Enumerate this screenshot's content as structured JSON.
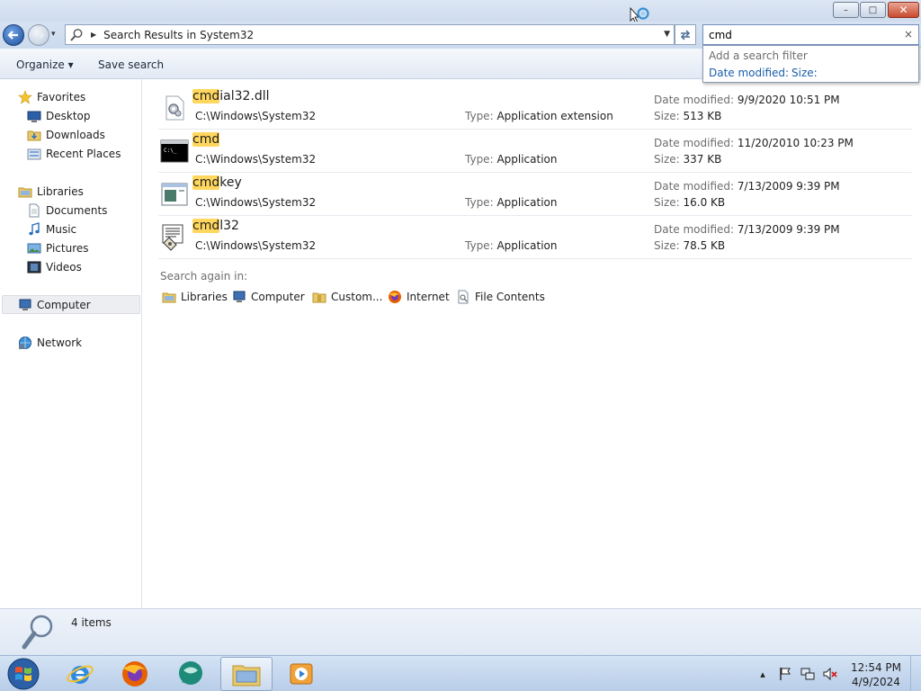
{
  "window": {
    "title_buttons": {
      "minimize": "–",
      "maximize": "□",
      "close": "✕"
    }
  },
  "navigation": {
    "address_path": "Search Results in System32",
    "search_query": "cmd",
    "search_clear": "×"
  },
  "filter_popup": {
    "title": "Add a search filter",
    "date_modified": "Date modified:",
    "size": "Size:"
  },
  "toolbar": {
    "organize_label": "Organize ▾",
    "save_search_label": "Save search"
  },
  "sidebar": {
    "favorites": {
      "label": "Favorites",
      "items": [
        "Desktop",
        "Downloads",
        "Recent Places"
      ]
    },
    "libraries": {
      "label": "Libraries",
      "items": [
        "Documents",
        "Music",
        "Pictures",
        "Videos"
      ]
    },
    "computer": "Computer",
    "network": "Network"
  },
  "results": [
    {
      "icon": "dll-gear-icon",
      "match": "cmd",
      "rest": "ial32.dll",
      "path": "C:\\Windows\\System32",
      "type_label": "Type:",
      "type": "Application extension",
      "date_label": "Date modified:",
      "date": "9/9/2020 10:51 PM",
      "size_label": "Size:",
      "size": "513 KB"
    },
    {
      "icon": "command-prompt-icon",
      "match": "cmd",
      "rest": "",
      "path": "C:\\Windows\\System32",
      "type_label": "Type:",
      "type": "Application",
      "date_label": "Date modified:",
      "date": "11/20/2010 10:23 PM",
      "size_label": "Size:",
      "size": "337 KB"
    },
    {
      "icon": "window-app-icon",
      "match": "cmd",
      "rest": "key",
      "path": "C:\\Windows\\System32",
      "type_label": "Type:",
      "type": "Application",
      "date_label": "Date modified:",
      "date": "7/13/2009 9:39 PM",
      "size_label": "Size:",
      "size": "16.0 KB"
    },
    {
      "icon": "installer-icon",
      "match": "cmd",
      "rest": "l32",
      "path": "C:\\Windows\\System32",
      "type_label": "Type:",
      "type": "Application",
      "date_label": "Date modified:",
      "date": "7/13/2009 9:39 PM",
      "size_label": "Size:",
      "size": "78.5 KB"
    }
  ],
  "search_again": {
    "label": "Search again in:",
    "options": [
      "Libraries",
      "Computer",
      "Custom...",
      "Internet",
      "File Contents"
    ]
  },
  "details": {
    "count": "4 items"
  },
  "taskbar": {
    "clock_time": "12:54 PM",
    "clock_date": "4/9/2024",
    "tray_expand": "▴"
  },
  "colors": {
    "highlight": "#ffd75e",
    "link_blue": "#1a5eab",
    "label_gray": "#6d6d6d"
  }
}
